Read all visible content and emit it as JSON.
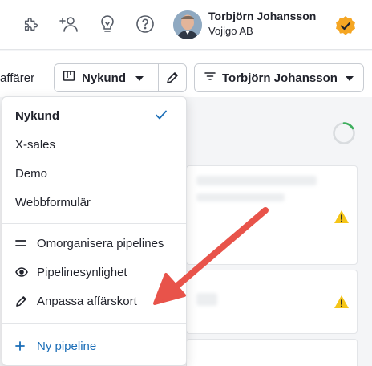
{
  "topbar": {
    "icons": [
      "puzzle-icon",
      "add-user-icon",
      "lightbulb-icon",
      "help-icon"
    ],
    "user_name": "Torbjörn Johansson",
    "company": "Vojigo AB",
    "badge_color": "#f5a623"
  },
  "filters": {
    "page_label_partial": "affärer",
    "pipeline": "Nykund",
    "owner": "Torbjörn Johansson"
  },
  "menu": {
    "pipelines": [
      {
        "label": "Nykund",
        "selected": true
      },
      {
        "label": "X-sales",
        "selected": false
      },
      {
        "label": "Demo",
        "selected": false
      },
      {
        "label": "Webbformulär",
        "selected": false
      }
    ],
    "actions": [
      {
        "label": "Omorganisera pipelines",
        "icon": "reorder-icon"
      },
      {
        "label": "Pipelinesynlighet",
        "icon": "eye-icon"
      },
      {
        "label": "Anpassa affärskort",
        "icon": "pencil-icon"
      }
    ],
    "new_pipeline": "Ny pipeline"
  },
  "colors": {
    "accent": "#1a6db7",
    "warning": "#f5c518",
    "annotation_arrow": "#e8534a"
  }
}
